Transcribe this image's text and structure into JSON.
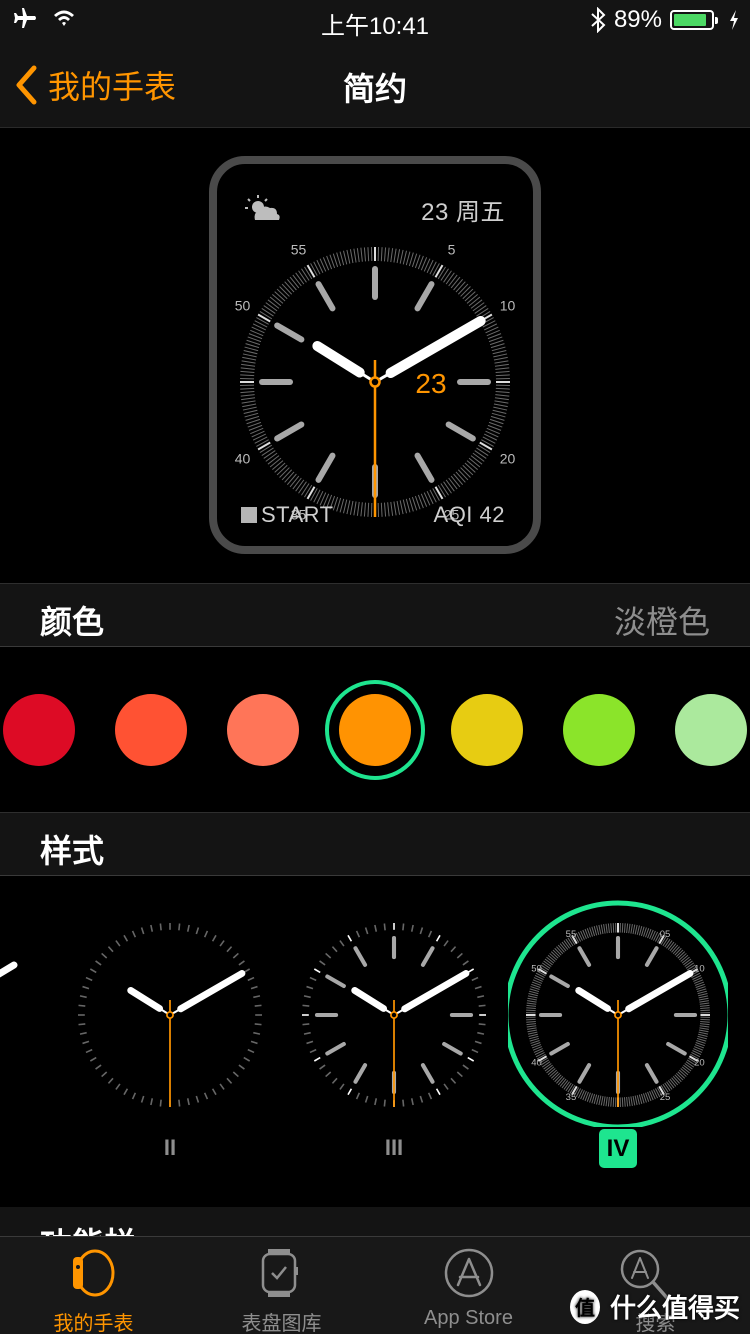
{
  "status_bar": {
    "time": "上午10:41",
    "battery_percent_label": "89%",
    "battery_level": 0.89,
    "icons": [
      "airplane-icon",
      "wifi-icon",
      "bluetooth-icon",
      "battery-icon",
      "charging-icon"
    ]
  },
  "nav": {
    "back_label": "我的手表",
    "title": "简约"
  },
  "preview": {
    "date_complication": "23 周五",
    "date_center": "23",
    "bottom_left": "START",
    "bottom_right": "AQI 42",
    "minute_labels": [
      "55",
      "5",
      "50",
      "10",
      "40",
      "20",
      "35",
      "25"
    ],
    "weather_icon": "partly-cloudy-icon"
  },
  "color_section": {
    "title": "颜色",
    "selected_value": "淡橙色",
    "swatches": [
      {
        "name": "red",
        "color": "#dd0b25"
      },
      {
        "name": "orange-red",
        "color": "#ff5233"
      },
      {
        "name": "salmon",
        "color": "#ff7558"
      },
      {
        "name": "light-orange",
        "color": "#ff9302",
        "selected": true
      },
      {
        "name": "yellow",
        "color": "#e7cc12"
      },
      {
        "name": "green",
        "color": "#8be42a"
      },
      {
        "name": "light-green",
        "color": "#abe99d"
      }
    ],
    "selection_ring_color": "#1ee58f"
  },
  "style_section": {
    "title": "样式",
    "styles": [
      {
        "label": "II",
        "selected": false
      },
      {
        "label": "III",
        "selected": false
      },
      {
        "label": "IV",
        "selected": true
      }
    ],
    "style_iv_numbers": [
      "55",
      "05",
      "50",
      "10",
      "40",
      "20",
      "35",
      "25"
    ]
  },
  "next_section": {
    "title": "功能栏"
  },
  "tab_bar": {
    "tabs": [
      {
        "label": "我的手表",
        "icon": "watch-band-icon",
        "active": true
      },
      {
        "label": "表盘图库",
        "icon": "watch-face-gallery-icon",
        "active": false
      },
      {
        "label": "App Store",
        "icon": "app-store-icon",
        "active": false
      },
      {
        "label": "搜索",
        "icon": "search-app-icon",
        "active": false
      }
    ]
  },
  "watermark": {
    "badge": "值",
    "text": "什么值得买"
  },
  "accent_color": "#ff9500"
}
